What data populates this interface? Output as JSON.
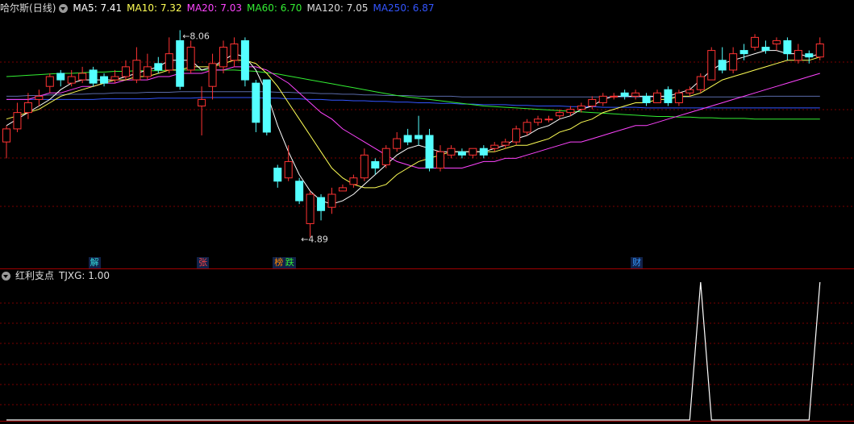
{
  "header": {
    "stock_name": "哈尔斯",
    "period": "(日线)",
    "indicators": [
      {
        "label": "MA5: 7.41",
        "color": "#ffffff"
      },
      {
        "label": "MA10: 7.32",
        "color": "#ffff55"
      },
      {
        "label": "MA20: 7.03",
        "color": "#ff44ff"
      },
      {
        "label": "MA60: 6.70",
        "color": "#33ee33"
      },
      {
        "label": "MA120: 7.05",
        "color": "#dddddd"
      },
      {
        "label": "MA250: 6.87",
        "color": "#3355ff"
      }
    ]
  },
  "sub_header": {
    "indicator_name": "红利支点",
    "value_label": "TJXG: 1.00"
  },
  "events": [
    {
      "label": "解",
      "color": "#33dddd",
      "bar": 8
    },
    {
      "label": "张",
      "color": "#ff4444",
      "bar": 18
    },
    {
      "label": "榜",
      "color": "#ff8800",
      "bar": 25
    },
    {
      "label": "跌",
      "color": "#33ee33",
      "bar": 26
    },
    {
      "label": "财",
      "color": "#3399ff",
      "bar": 58
    }
  ],
  "colors": {
    "up": "#ff3333",
    "down": "#54ffff",
    "grid": "#7a0000",
    "axis": "#a00000",
    "signal": "#ffffff"
  },
  "chart_data": [
    {
      "type": "candlestick",
      "title": "哈尔斯 (日线)",
      "ylim": [
        4.6,
        8.3
      ],
      "max_label": "8.06",
      "min_label": "4.89",
      "max_value": 8.06,
      "min_value": 4.89,
      "max_bar": 16,
      "min_bar": 27,
      "candles": [
        [
          6.35,
          6.55,
          6.1,
          6.6
        ],
        [
          6.55,
          6.8,
          6.5,
          6.95
        ],
        [
          6.8,
          6.95,
          6.7,
          7.1
        ],
        [
          7.0,
          7.05,
          6.9,
          7.15
        ],
        [
          7.2,
          7.35,
          7.1,
          7.4
        ],
        [
          7.4,
          7.3,
          7.2,
          7.45
        ],
        [
          7.25,
          7.35,
          7.2,
          7.45
        ],
        [
          7.3,
          7.4,
          7.25,
          7.5
        ],
        [
          7.45,
          7.25,
          7.2,
          7.5
        ],
        [
          7.35,
          7.25,
          7.2,
          7.4
        ],
        [
          7.3,
          7.35,
          7.25,
          7.45
        ],
        [
          7.35,
          7.5,
          7.3,
          7.6
        ],
        [
          7.3,
          7.6,
          7.25,
          7.8
        ],
        [
          7.35,
          7.5,
          7.3,
          7.7
        ],
        [
          7.55,
          7.45,
          7.4,
          7.65
        ],
        [
          7.45,
          7.7,
          7.4,
          7.95
        ],
        [
          7.9,
          7.2,
          7.15,
          8.06
        ],
        [
          7.45,
          7.8,
          7.4,
          7.9
        ],
        [
          6.9,
          7.0,
          6.45,
          7.2
        ],
        [
          7.2,
          7.55,
          7.0,
          7.7
        ],
        [
          7.5,
          7.8,
          7.4,
          7.9
        ],
        [
          7.6,
          7.85,
          7.5,
          7.95
        ],
        [
          7.9,
          7.3,
          7.2,
          7.95
        ],
        [
          7.25,
          6.65,
          6.5,
          7.3
        ],
        [
          7.3,
          6.5,
          6.45,
          7.3
        ],
        [
          5.95,
          5.75,
          5.65,
          6.0
        ],
        [
          5.8,
          6.05,
          5.75,
          6.3
        ],
        [
          5.75,
          5.45,
          5.4,
          5.8
        ],
        [
          5.1,
          5.55,
          4.89,
          5.6
        ],
        [
          5.5,
          5.3,
          5.15,
          5.55
        ],
        [
          5.35,
          5.55,
          5.25,
          5.65
        ],
        [
          5.6,
          5.65,
          5.6,
          5.7
        ],
        [
          5.7,
          5.8,
          5.65,
          5.85
        ],
        [
          5.8,
          6.15,
          5.75,
          6.25
        ],
        [
          6.05,
          5.95,
          5.85,
          6.1
        ],
        [
          6.0,
          6.25,
          5.95,
          6.3
        ],
        [
          6.25,
          6.4,
          6.2,
          6.5
        ],
        [
          6.45,
          6.35,
          6.3,
          6.55
        ],
        [
          6.45,
          6.4,
          6.3,
          6.75
        ],
        [
          6.45,
          5.95,
          5.9,
          6.55
        ],
        [
          5.95,
          6.2,
          5.9,
          6.3
        ],
        [
          6.15,
          6.25,
          6.1,
          6.3
        ],
        [
          6.2,
          6.15,
          6.1,
          6.25
        ],
        [
          6.15,
          6.25,
          6.1,
          6.25
        ],
        [
          6.25,
          6.15,
          6.1,
          6.3
        ],
        [
          6.25,
          6.3,
          6.2,
          6.35
        ],
        [
          6.3,
          6.35,
          6.25,
          6.4
        ],
        [
          6.35,
          6.55,
          6.3,
          6.6
        ],
        [
          6.5,
          6.65,
          6.45,
          6.7
        ],
        [
          6.65,
          6.7,
          6.6,
          6.75
        ],
        [
          6.7,
          6.7,
          6.65,
          6.75
        ],
        [
          6.75,
          6.8,
          6.7,
          6.85
        ],
        [
          6.8,
          6.85,
          6.75,
          6.9
        ],
        [
          6.85,
          6.9,
          6.8,
          6.95
        ],
        [
          6.9,
          7.0,
          6.85,
          7.05
        ],
        [
          6.95,
          7.05,
          6.9,
          7.1
        ],
        [
          7.05,
          7.05,
          7.0,
          7.1
        ],
        [
          7.1,
          7.05,
          7.0,
          7.15
        ],
        [
          7.05,
          7.1,
          7.0,
          7.15
        ],
        [
          7.05,
          6.95,
          6.9,
          7.1
        ],
        [
          6.95,
          7.1,
          6.95,
          7.15
        ],
        [
          7.15,
          6.95,
          6.9,
          7.2
        ],
        [
          6.95,
          7.1,
          6.9,
          7.15
        ],
        [
          7.1,
          7.15,
          7.05,
          7.2
        ],
        [
          7.15,
          7.35,
          7.1,
          7.4
        ],
        [
          7.3,
          7.75,
          7.3,
          7.8
        ],
        [
          7.6,
          7.45,
          7.4,
          7.8
        ],
        [
          7.45,
          7.7,
          7.4,
          7.8
        ],
        [
          7.75,
          7.7,
          7.6,
          7.85
        ],
        [
          7.8,
          7.95,
          7.75,
          8.0
        ],
        [
          7.8,
          7.75,
          7.7,
          7.9
        ],
        [
          7.85,
          7.9,
          7.75,
          7.95
        ],
        [
          7.9,
          7.7,
          7.6,
          7.95
        ],
        [
          7.6,
          7.75,
          7.55,
          7.85
        ],
        [
          7.7,
          7.65,
          7.55,
          7.75
        ],
        [
          7.65,
          7.85,
          7.6,
          7.95
        ]
      ],
      "series": [
        {
          "name": "MA5",
          "color": "#ffffff",
          "values": [
            6.6,
            6.7,
            6.8,
            6.9,
            7.0,
            7.15,
            7.25,
            7.3,
            7.3,
            7.3,
            7.3,
            7.35,
            7.4,
            7.45,
            7.5,
            7.6,
            7.6,
            7.6,
            7.45,
            7.5,
            7.6,
            7.7,
            7.65,
            7.45,
            7.1,
            6.6,
            6.2,
            5.85,
            5.6,
            5.45,
            5.4,
            5.45,
            5.55,
            5.7,
            5.85,
            6.0,
            6.15,
            6.25,
            6.3,
            6.25,
            6.2,
            6.2,
            6.2,
            6.2,
            6.2,
            6.25,
            6.3,
            6.4,
            6.45,
            6.55,
            6.6,
            6.7,
            6.75,
            6.85,
            6.9,
            7.0,
            7.05,
            7.05,
            7.05,
            7.05,
            7.05,
            7.05,
            7.1,
            7.15,
            7.3,
            7.45,
            7.55,
            7.6,
            7.65,
            7.7,
            7.75,
            7.75,
            7.7,
            7.7,
            7.65,
            7.7
          ]
        },
        {
          "name": "MA10",
          "color": "#ffff55",
          "values": [
            6.7,
            6.75,
            6.8,
            6.85,
            6.95,
            7.05,
            7.1,
            7.15,
            7.2,
            7.25,
            7.3,
            7.3,
            7.35,
            7.35,
            7.4,
            7.45,
            7.45,
            7.5,
            7.5,
            7.5,
            7.55,
            7.6,
            7.6,
            7.55,
            7.4,
            7.2,
            6.95,
            6.7,
            6.45,
            6.2,
            5.95,
            5.8,
            5.7,
            5.65,
            5.65,
            5.7,
            5.85,
            5.95,
            6.05,
            6.1,
            6.15,
            6.2,
            6.2,
            6.2,
            6.2,
            6.2,
            6.25,
            6.3,
            6.3,
            6.35,
            6.4,
            6.5,
            6.55,
            6.65,
            6.7,
            6.8,
            6.85,
            6.9,
            6.95,
            6.95,
            7.0,
            7.0,
            7.05,
            7.05,
            7.1,
            7.2,
            7.3,
            7.35,
            7.4,
            7.45,
            7.5,
            7.55,
            7.6,
            7.6,
            7.6,
            7.65
          ]
        },
        {
          "name": "MA20",
          "color": "#ff44ff",
          "values": [
            7.0,
            7.0,
            7.0,
            7.05,
            7.1,
            7.1,
            7.15,
            7.2,
            7.2,
            7.25,
            7.25,
            7.3,
            7.3,
            7.3,
            7.35,
            7.35,
            7.4,
            7.4,
            7.4,
            7.45,
            7.45,
            7.5,
            7.5,
            7.5,
            7.45,
            7.35,
            7.25,
            7.1,
            6.95,
            6.8,
            6.7,
            6.55,
            6.45,
            6.35,
            6.25,
            6.15,
            6.05,
            6.0,
            5.95,
            5.95,
            5.95,
            5.95,
            5.95,
            6.0,
            6.05,
            6.05,
            6.1,
            6.1,
            6.15,
            6.2,
            6.25,
            6.3,
            6.35,
            6.35,
            6.4,
            6.45,
            6.5,
            6.55,
            6.6,
            6.6,
            6.65,
            6.7,
            6.75,
            6.8,
            6.85,
            6.9,
            6.95,
            7.0,
            7.05,
            7.1,
            7.15,
            7.2,
            7.25,
            7.3,
            7.35,
            7.4
          ]
        },
        {
          "name": "MA60",
          "color": "#33ee33",
          "values": [
            7.35,
            7.36,
            7.37,
            7.38,
            7.39,
            7.4,
            7.4,
            7.41,
            7.42,
            7.42,
            7.43,
            7.43,
            7.44,
            7.44,
            7.44,
            7.45,
            7.45,
            7.45,
            7.45,
            7.45,
            7.45,
            7.45,
            7.44,
            7.43,
            7.41,
            7.39,
            7.36,
            7.33,
            7.3,
            7.27,
            7.24,
            7.21,
            7.18,
            7.15,
            7.12,
            7.09,
            7.06,
            7.04,
            7.02,
            7.0,
            6.98,
            6.96,
            6.94,
            6.92,
            6.9,
            6.89,
            6.88,
            6.87,
            6.86,
            6.85,
            6.84,
            6.83,
            6.82,
            6.81,
            6.8,
            6.79,
            6.78,
            6.77,
            6.76,
            6.75,
            6.74,
            6.74,
            6.73,
            6.73,
            6.72,
            6.72,
            6.71,
            6.71,
            6.71,
            6.7,
            6.7,
            6.7,
            6.7,
            6.7,
            6.7,
            6.7
          ]
        },
        {
          "name": "MA120",
          "color": "#dddddd",
          "values": [
            7.05,
            7.05,
            7.06,
            7.06,
            7.07,
            7.07,
            7.08,
            7.08,
            7.09,
            7.09,
            7.1,
            7.1,
            7.1,
            7.11,
            7.11,
            7.11,
            7.12,
            7.12,
            7.12,
            7.12,
            7.12,
            7.12,
            7.12,
            7.12,
            7.12,
            7.11,
            7.11,
            7.1,
            7.1,
            7.09,
            7.09,
            7.08,
            7.08,
            7.07,
            7.07,
            7.06,
            7.06,
            7.06,
            7.05,
            7.05,
            7.05,
            7.05,
            7.04,
            7.04,
            7.04,
            7.04,
            7.04,
            7.04,
            7.04,
            7.04,
            7.04,
            7.04,
            7.04,
            7.04,
            7.04,
            7.04,
            7.04,
            7.04,
            7.04,
            7.04,
            7.04,
            7.04,
            7.04,
            7.04,
            7.04,
            7.04,
            7.04,
            7.04,
            7.04,
            7.04,
            7.05,
            7.05,
            7.05,
            7.05,
            7.05,
            7.05
          ]
        },
        {
          "name": "MA250",
          "color": "#3355ff",
          "values": [
            7.0,
            7.0,
            7.0,
            7.0,
            7.0,
            7.0,
            7.0,
            7.0,
            7.0,
            7.01,
            7.01,
            7.01,
            7.01,
            7.01,
            7.02,
            7.02,
            7.02,
            7.02,
            7.03,
            7.03,
            7.03,
            7.03,
            7.03,
            7.03,
            7.02,
            7.02,
            7.01,
            7.01,
            7.0,
            7.0,
            6.99,
            6.99,
            6.98,
            6.98,
            6.97,
            6.97,
            6.96,
            6.96,
            6.95,
            6.95,
            6.94,
            6.94,
            6.93,
            6.93,
            6.92,
            6.92,
            6.92,
            6.91,
            6.91,
            6.9,
            6.9,
            6.9,
            6.89,
            6.89,
            6.89,
            6.88,
            6.88,
            6.88,
            6.88,
            6.87,
            6.87,
            6.87,
            6.87,
            6.87,
            6.87,
            6.87,
            6.87,
            6.87,
            6.87,
            6.87,
            6.87,
            6.87,
            6.87,
            6.87,
            6.87,
            6.87
          ]
        }
      ]
    },
    {
      "type": "line",
      "title": "红利支点",
      "ylim": [
        0,
        1
      ],
      "series": [
        {
          "name": "TJXG",
          "color": "#ffffff",
          "values": [
            0,
            0,
            0,
            0,
            0,
            0,
            0,
            0,
            0,
            0,
            0,
            0,
            0,
            0,
            0,
            0,
            0,
            0,
            0,
            0,
            0,
            0,
            0,
            0,
            0,
            0,
            0,
            0,
            0,
            0,
            0,
            0,
            0,
            0,
            0,
            0,
            0,
            0,
            0,
            0,
            0,
            0,
            0,
            0,
            0,
            0,
            0,
            0,
            0,
            0,
            0,
            0,
            0,
            0,
            0,
            0,
            0,
            0,
            0,
            0,
            0,
            0,
            0,
            0,
            1,
            0,
            0,
            0,
            0,
            0,
            0,
            0,
            0,
            0,
            0,
            1
          ]
        }
      ]
    }
  ]
}
